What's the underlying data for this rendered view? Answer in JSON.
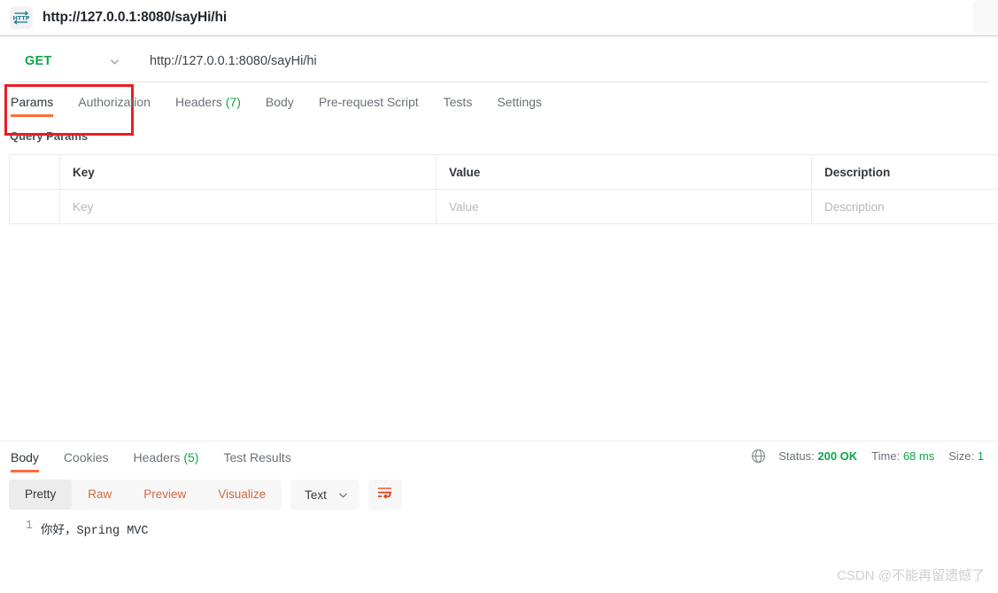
{
  "header": {
    "icon": "http-icon",
    "title": "http://127.0.0.1:8080/sayHi/hi"
  },
  "request": {
    "method": "GET",
    "method_color": "#10a54a",
    "url": "http://127.0.0.1:8080/sayHi/hi",
    "annotation_color": "#ed1c24",
    "tabs": [
      {
        "label": "Params",
        "count": "",
        "active": true
      },
      {
        "label": "Authorization",
        "count": "",
        "active": false
      },
      {
        "label": "Headers",
        "count": "(7)",
        "active": false
      },
      {
        "label": "Body",
        "count": "",
        "active": false
      },
      {
        "label": "Pre-request Script",
        "count": "",
        "active": false
      },
      {
        "label": "Tests",
        "count": "",
        "active": false
      },
      {
        "label": "Settings",
        "count": "",
        "active": false
      }
    ],
    "params": {
      "section_title": "Query Params",
      "columns": [
        "",
        "Key",
        "Value",
        "Description"
      ],
      "rows": [
        {
          "key": "Key",
          "value": "Value",
          "description": "Description"
        }
      ]
    }
  },
  "response": {
    "tabs": [
      {
        "label": "Body",
        "count": "",
        "active": true
      },
      {
        "label": "Cookies",
        "count": "",
        "active": false
      },
      {
        "label": "Headers",
        "count": "(5)",
        "active": false
      },
      {
        "label": "Test Results",
        "count": "",
        "active": false
      }
    ],
    "status": {
      "globe_icon": "globe-icon",
      "status_label": "Status:",
      "status_value": "200 OK",
      "time_label": "Time:",
      "time_value": "68 ms",
      "size_label": "Size:",
      "size_value": "1",
      "ok_color": "#10a54a"
    },
    "viewer": {
      "modes": [
        {
          "label": "Pretty",
          "active": true
        },
        {
          "label": "Raw",
          "active": false
        },
        {
          "label": "Preview",
          "active": false
        },
        {
          "label": "Visualize",
          "active": false
        }
      ],
      "format": "Text",
      "wrap_icon": "wrap-lines-icon",
      "accent_color": "#ff6c37"
    },
    "body": {
      "lines": [
        {
          "number": "1",
          "text": "你好，Spring MVC"
        }
      ]
    }
  },
  "watermark": "CSDN @不能再留遗憾了"
}
